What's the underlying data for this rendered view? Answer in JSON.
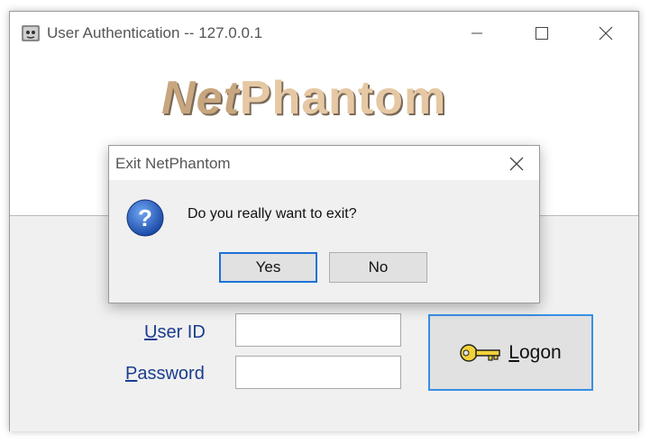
{
  "window": {
    "title": "User Authentication -- 127.0.0.1",
    "icons": {
      "app": "netphantom-app-icon",
      "minimize": "minimize-icon",
      "maximize": "maximize-icon",
      "close": "close-icon"
    }
  },
  "logo": {
    "part1": "Net",
    "part2": "Phantom"
  },
  "login": {
    "userid_prefix": "U",
    "userid_rest": "ser ID",
    "password_prefix": "P",
    "password_rest": "assword",
    "userid_value": "",
    "password_value": "",
    "logon_prefix": "L",
    "logon_rest": "ogon",
    "logon_icon": "key-icon"
  },
  "dialog": {
    "title": "Exit NetPhantom",
    "message": "Do you really want to exit?",
    "yes_label": "Yes",
    "no_label": "No",
    "icon": "question-icon"
  },
  "colors": {
    "focus_accent": "#1b72d6",
    "label_blue": "#1a3d8f",
    "logo_tan": "#c8a67f"
  }
}
